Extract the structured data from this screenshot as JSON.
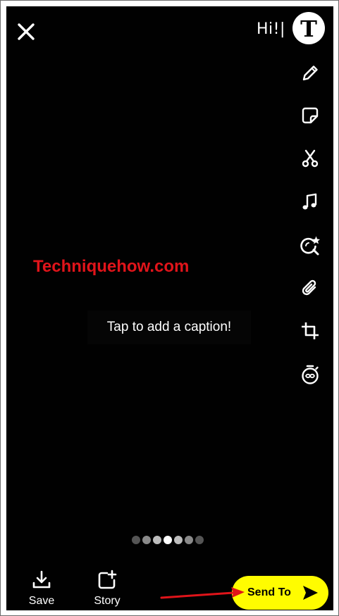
{
  "overlay_text": "Hi!|",
  "text_tool_label": "T",
  "watermark": "Techniquehow.com",
  "caption_placeholder": "Tap to add a caption!",
  "tools": [
    "pencil-icon",
    "sticker-icon",
    "scissors-icon",
    "music-icon",
    "lens-search-icon",
    "paperclip-icon",
    "crop-icon",
    "timer-icon"
  ],
  "pager": {
    "count": 7,
    "active_index": 3
  },
  "bottom": {
    "save_label": "Save",
    "story_label": "Story",
    "send_label": "Send To"
  },
  "colors": {
    "background": "#010101",
    "send_button": "#fffc00",
    "watermark": "#e0141a",
    "annotation_arrow": "#e0141a"
  }
}
